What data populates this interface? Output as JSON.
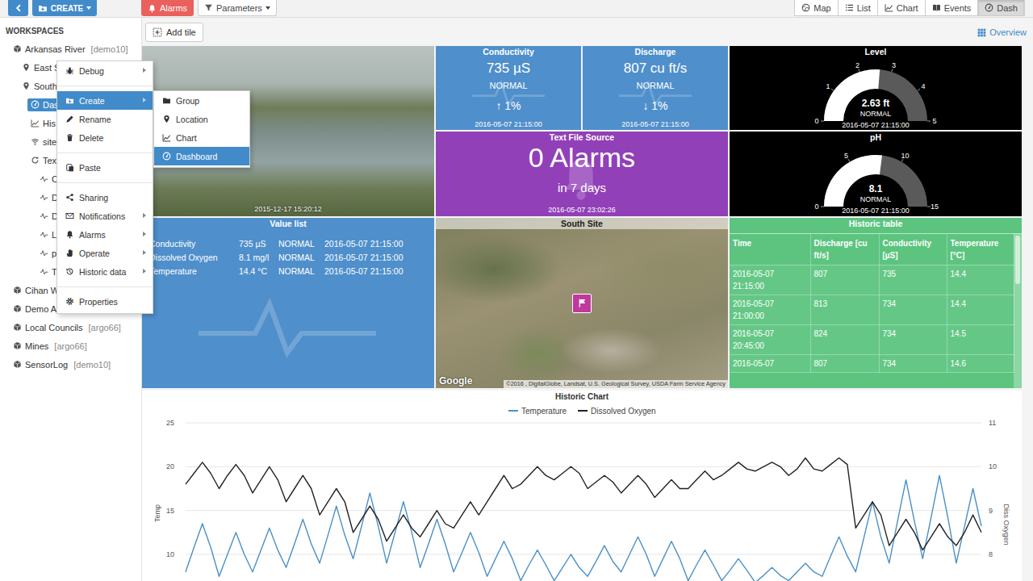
{
  "toolbar": {
    "create": "CREATE",
    "alarms": "Alarms",
    "parameters": "Parameters"
  },
  "views": [
    {
      "label": "Map",
      "selected": false
    },
    {
      "label": "List",
      "selected": false
    },
    {
      "label": "Chart",
      "selected": false
    },
    {
      "label": "Events",
      "selected": false
    },
    {
      "label": "Dash",
      "selected": true
    }
  ],
  "sidebar": {
    "title": "WORKSPACES",
    "items": [
      {
        "label": "Arkansas River",
        "tag": "[demo10]",
        "kind": "workspace",
        "depth": 0,
        "selected": false
      },
      {
        "label": "East S",
        "kind": "location",
        "depth": 1,
        "selected": false
      },
      {
        "label": "South",
        "kind": "location",
        "depth": 1,
        "selected": false
      },
      {
        "label": "Das",
        "kind": "dashboard",
        "depth": 2,
        "selected": true
      },
      {
        "label": "His",
        "kind": "chart",
        "depth": 2,
        "selected": false
      },
      {
        "label": "site",
        "kind": "site",
        "depth": 2,
        "selected": false
      },
      {
        "label": "Tex",
        "kind": "source",
        "depth": 2,
        "selected": false
      },
      {
        "label": "C",
        "kind": "sensor",
        "depth": 3,
        "selected": false
      },
      {
        "label": "D",
        "kind": "sensor",
        "depth": 3,
        "selected": false
      },
      {
        "label": "D",
        "kind": "sensor",
        "depth": 3,
        "selected": false
      },
      {
        "label": "L",
        "kind": "sensor",
        "depth": 3,
        "selected": false
      },
      {
        "label": "p",
        "kind": "sensor",
        "depth": 3,
        "selected": false
      },
      {
        "label": "T",
        "kind": "sensor",
        "depth": 3,
        "selected": false
      },
      {
        "label": "Cihan W",
        "kind": "workspace",
        "depth": 0,
        "selected": false
      },
      {
        "label": "Demo A",
        "kind": "workspace",
        "depth": 0,
        "selected": false
      },
      {
        "label": "Local Councils",
        "tag": "[argo66]",
        "kind": "workspace",
        "depth": 0,
        "selected": false
      },
      {
        "label": "Mines",
        "tag": "[argo66]",
        "kind": "workspace",
        "depth": 0,
        "selected": false
      },
      {
        "label": "SensorLog",
        "tag": "[demo10]",
        "kind": "workspace",
        "depth": 0,
        "selected": false
      }
    ]
  },
  "context_menu": {
    "items": [
      {
        "kind": "item",
        "label": "Debug",
        "submenu": true,
        "selected": false
      },
      {
        "kind": "separator"
      },
      {
        "kind": "item",
        "label": "Create",
        "submenu": true,
        "selected": true
      },
      {
        "kind": "item",
        "label": "Rename",
        "submenu": false,
        "selected": false
      },
      {
        "kind": "item",
        "label": "Delete",
        "submenu": false,
        "selected": false
      },
      {
        "kind": "separator"
      },
      {
        "kind": "item",
        "label": "Paste",
        "submenu": false,
        "selected": false
      },
      {
        "kind": "separator"
      },
      {
        "kind": "item",
        "label": "Sharing",
        "submenu": false,
        "selected": false
      },
      {
        "kind": "item",
        "label": "Notifications",
        "submenu": true,
        "selected": false
      },
      {
        "kind": "item",
        "label": "Alarms",
        "submenu": true,
        "selected": false
      },
      {
        "kind": "item",
        "label": "Operate",
        "submenu": true,
        "selected": false
      },
      {
        "kind": "item",
        "label": "Historic data",
        "submenu": true,
        "selected": false
      },
      {
        "kind": "separator"
      },
      {
        "kind": "item",
        "label": "Properties",
        "submenu": false,
        "selected": false
      }
    ]
  },
  "submenu": {
    "items": [
      {
        "label": "Group",
        "selected": false
      },
      {
        "label": "Location",
        "selected": false
      },
      {
        "label": "Chart",
        "selected": false
      },
      {
        "label": "Dashboard",
        "selected": true
      }
    ]
  },
  "main_toolbar": {
    "add_tile": "Add tile",
    "overview": "Overview"
  },
  "tiles": [
    {
      "kind": "image",
      "timestamp": "2015-12-17 15:20:12"
    },
    {
      "kind": "value",
      "title": "Conductivity",
      "value": "735 µS",
      "status": "NORMAL",
      "trend": "↑ 1%",
      "timestamp": "2016-05-07 21:15:00",
      "color": "#4f8fcb"
    },
    {
      "kind": "value",
      "title": "Discharge",
      "value": "807 cu ft/s",
      "status": "NORMAL",
      "trend": "↓ 1%",
      "timestamp": "2016-05-07 21:15:00",
      "color": "#4f8fcb"
    },
    {
      "kind": "gauge",
      "title": "Level",
      "value": "2.63 ft",
      "status": "NORMAL",
      "timestamp": "2016-05-07 21:15:00",
      "ticks": [
        "0",
        "1",
        "2",
        "3",
        "4",
        "5"
      ],
      "level": 0.526,
      "color": "#000000"
    },
    {
      "kind": "alarms",
      "title": "Text File Source",
      "value": "0 Alarms",
      "period": "in 7 days",
      "timestamp": "2016-05-07 23:02:26",
      "color": "#9140b8"
    },
    {
      "kind": "gauge",
      "title": "pH",
      "value": "8.1",
      "status": "NORMAL",
      "timestamp": "2016-05-07 21:15:00",
      "ticks": [
        "0",
        "5",
        "10",
        "15"
      ],
      "level": 0.54,
      "color": "#000000"
    },
    {
      "kind": "list",
      "title": "Value list",
      "rows": [
        [
          "Conductivity",
          "735 µS",
          "NORMAL",
          "2016-05-07 21:15:00"
        ],
        [
          "Dissolved Oxygen",
          "8.1 mg/l",
          "NORMAL",
          "2016-05-07 21:15:00"
        ],
        [
          "Temperature",
          "14.4 °C",
          "NORMAL",
          "2016-05-07 21:15:00"
        ]
      ],
      "color": "#4f8fcb"
    },
    {
      "kind": "map",
      "title": "South Site",
      "provider": "Google",
      "attribution": "©2016 , DigitalGlobe, Landsat, U.S. Geological Survey, USDA Farm Service Agency"
    },
    {
      "kind": "table",
      "title": "Historic table",
      "columns": [
        "Time",
        "Discharge [cu ft/s]",
        "Conductivity [µS]",
        "Temperature [°C]"
      ],
      "rows": [
        [
          "2016-05-07 21:15:00",
          "807",
          "735",
          "14.4"
        ],
        [
          "2016-05-07 21:00:00",
          "813",
          "734",
          "14.4"
        ],
        [
          "2016-05-07 20:45:00",
          "824",
          "734",
          "14.5"
        ],
        [
          "2016-05-07",
          "807",
          "734",
          "14.6"
        ]
      ],
      "color": "#5cc47f"
    }
  ],
  "chart": {
    "title": "Historic Chart",
    "left_axis": {
      "label": "Temp",
      "ticks": [
        "25",
        "20",
        "15",
        "10"
      ]
    },
    "right_axis": {
      "label": "Diss Oxygen",
      "ticks": [
        "11",
        "10",
        "9",
        "8"
      ]
    },
    "series": [
      {
        "name": "Temperature",
        "color": "#4a90c8",
        "axis": "left",
        "values": [
          8,
          10.8,
          13.5,
          10.8,
          7.5,
          10,
          12.5,
          10,
          8,
          10.5,
          13,
          10.5,
          8.5,
          11.2,
          14,
          11.2,
          9,
          12.2,
          15.5,
          12.2,
          9.5,
          13.2,
          17,
          13.2,
          9,
          12.5,
          16,
          12.5,
          8.5,
          11.2,
          14,
          11.2,
          8,
          10.2,
          12.5,
          10.2,
          7.5,
          9.5,
          11.5,
          9.5,
          7,
          8.8,
          10.5,
          8.8,
          7,
          8.5,
          10,
          8.5,
          7.5,
          9.2,
          11,
          9.2,
          8,
          10,
          12,
          10,
          7.5,
          9.5,
          11.5,
          9.5,
          7,
          8.8,
          10.5,
          8.8,
          7,
          8.2,
          9.5,
          8.2,
          6.8,
          7.6,
          8.5,
          7.6,
          7,
          8,
          9,
          8,
          7.5,
          9.8,
          12,
          9.8,
          8,
          12,
          16,
          12,
          9,
          13.8,
          18.5,
          13.8,
          9.5,
          14.2,
          19,
          14.2,
          9,
          13.2,
          17.5,
          13.2
        ]
      },
      {
        "name": "Dissolved Oxygen",
        "color": "#222222",
        "axis": "right",
        "values": [
          9.6,
          9.85,
          10.1,
          9.85,
          9.5,
          9.8,
          10.05,
          9.8,
          9.4,
          9.7,
          10,
          9.7,
          9.2,
          9.5,
          9.8,
          9.5,
          8.9,
          9.2,
          9.5,
          9.2,
          8.5,
          8.8,
          9.1,
          8.8,
          8.3,
          8.6,
          8.9,
          8.6,
          8.4,
          8.7,
          9,
          8.7,
          8.6,
          8.9,
          9.2,
          8.9,
          9.2,
          9.5,
          9.8,
          9.5,
          9.6,
          9.8,
          10,
          9.8,
          9.7,
          9.85,
          10,
          9.85,
          9.5,
          9.65,
          9.8,
          9.65,
          9.4,
          9.6,
          9.8,
          9.6,
          9.3,
          9.5,
          9.7,
          9.5,
          9.5,
          9.7,
          9.9,
          9.7,
          9.8,
          9.95,
          10.1,
          9.95,
          9.9,
          10,
          10.1,
          10,
          9.8,
          9.95,
          10.2,
          9.95,
          9.9,
          10.05,
          10.2,
          10.05,
          8.6,
          8.9,
          9.2,
          8.9,
          8.2,
          8.5,
          8.8,
          8.5,
          8.1,
          8.4,
          8.7,
          8.4,
          8.2,
          8.5,
          8.9,
          8.5
        ]
      }
    ]
  }
}
